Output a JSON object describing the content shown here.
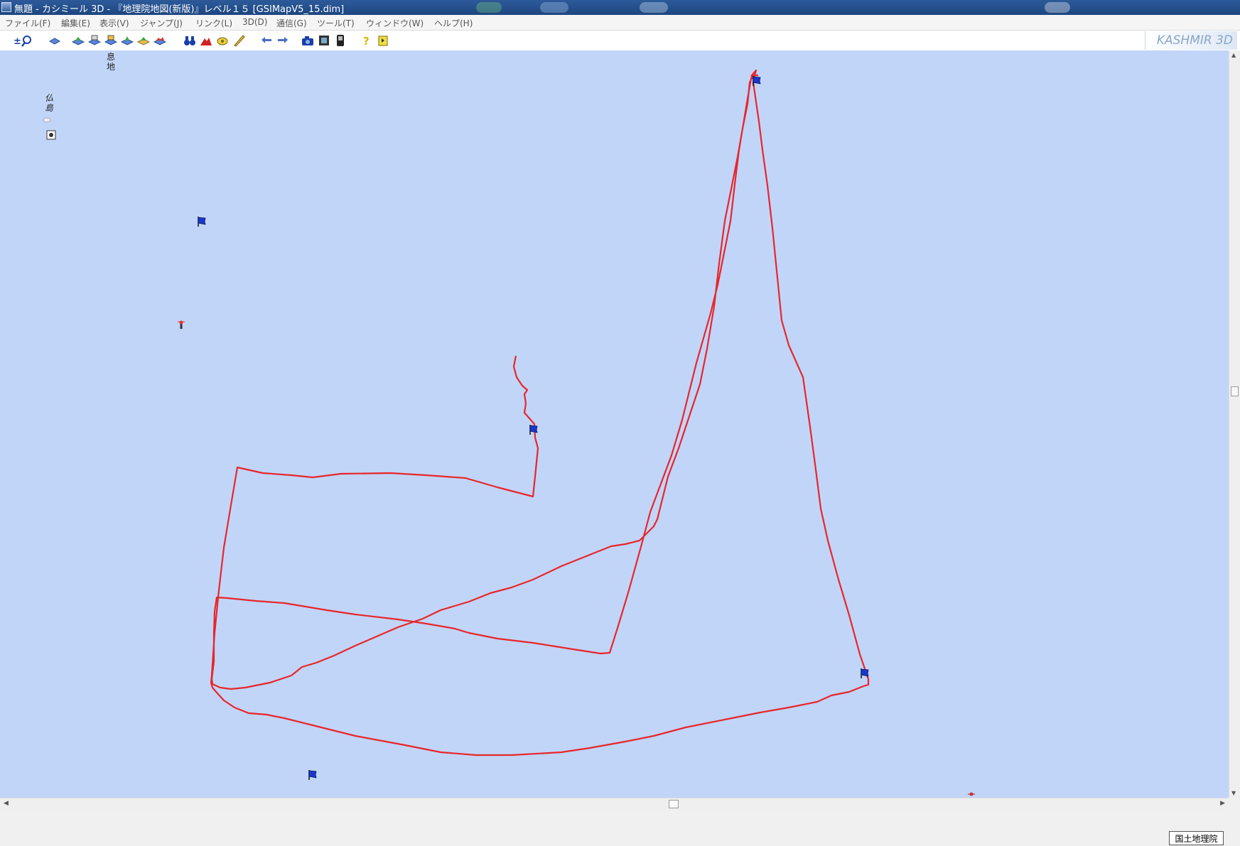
{
  "window": {
    "title": "無題 - カシミール 3D - 『地理院地図(新版)』レベル１５ [GSIMapV5_15.dim]"
  },
  "menu": [
    "ファイル(F)",
    "編集(E)",
    "表示(V)",
    "ジャンプ(J)",
    "リンク(L)",
    "3D(D)",
    "通信(G)",
    "ツール(T)",
    "ウィンドウ(W)",
    "ヘルプ(H)"
  ],
  "toolbar": {
    "buttons": [
      {
        "name": "zoom-search-icon"
      },
      {
        "name": "layer-icon"
      },
      {
        "name": "map-layer-1-icon"
      },
      {
        "name": "map-layer-2-icon"
      },
      {
        "name": "map-layer-3-icon"
      },
      {
        "name": "map-layer-4-icon"
      },
      {
        "name": "map-layer-5-icon"
      },
      {
        "name": "map-layer-6-icon"
      },
      {
        "name": "binoculars-icon"
      },
      {
        "name": "mountain-icon"
      },
      {
        "name": "waypoint-icon"
      },
      {
        "name": "ruler-icon"
      },
      {
        "name": "arrow-left-icon"
      },
      {
        "name": "arrow-right-icon"
      },
      {
        "name": "camera-icon"
      },
      {
        "name": "film-icon"
      },
      {
        "name": "gps-device-icon"
      },
      {
        "name": "help-icon"
      },
      {
        "name": "exit-icon"
      }
    ],
    "logo": "KASHMIR 3D"
  },
  "map": {
    "labels": [
      {
        "text": "息地",
        "name": "place-label-sokuchi"
      },
      {
        "text": "仏島",
        "name": "place-label-hotokejima"
      }
    ],
    "attribution": "国土地理院",
    "colors": {
      "water": "#c1d5f8",
      "track": "#e8262b",
      "flag": "#1b36c9"
    }
  }
}
